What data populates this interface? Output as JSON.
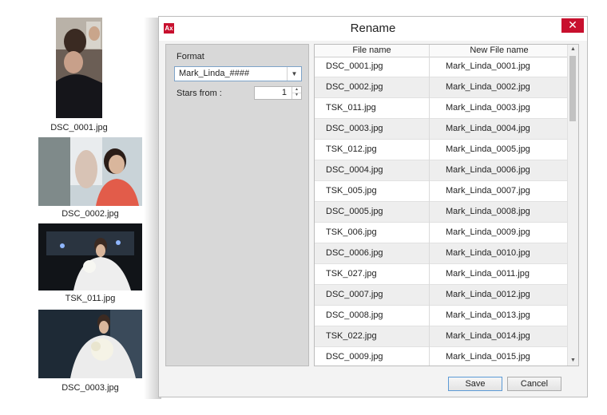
{
  "thumbnails": [
    {
      "caption": "DSC_0001.jpg"
    },
    {
      "caption": "DSC_0002.jpg"
    },
    {
      "caption": "TSK_011.jpg"
    },
    {
      "caption": "DSC_0003.jpg"
    }
  ],
  "dialog": {
    "title": "Rename",
    "app_icon_text": "Ax",
    "close_glyph": "✕"
  },
  "options": {
    "format_label": "Format",
    "format_value": "Mark_Linda_####",
    "stars_label": "Stars from :",
    "stars_value": "1"
  },
  "table": {
    "headers": [
      "File name",
      "New File name"
    ],
    "rows": [
      [
        "DSC_0001.jpg",
        "Mark_Linda_0001.jpg"
      ],
      [
        "DSC_0002.jpg",
        "Mark_Linda_0002.jpg"
      ],
      [
        "TSK_011.jpg",
        "Mark_Linda_0003.jpg"
      ],
      [
        "DSC_0003.jpg",
        "Mark_Linda_0004.jpg"
      ],
      [
        "TSK_012.jpg",
        "Mark_Linda_0005.jpg"
      ],
      [
        "DSC_0004.jpg",
        "Mark_Linda_0006.jpg"
      ],
      [
        "TSK_005.jpg",
        "Mark_Linda_0007.jpg"
      ],
      [
        "DSC_0005.jpg",
        "Mark_Linda_0008.jpg"
      ],
      [
        "TSK_006.jpg",
        "Mark_Linda_0009.jpg"
      ],
      [
        "DSC_0006.jpg",
        "Mark_Linda_0010.jpg"
      ],
      [
        "TSK_027.jpg",
        "Mark_Linda_0011.jpg"
      ],
      [
        "DSC_0007.jpg",
        "Mark_Linda_0012.jpg"
      ],
      [
        "DSC_0008.jpg",
        "Mark_Linda_0013.jpg"
      ],
      [
        "TSK_022.jpg",
        "Mark_Linda_0014.jpg"
      ],
      [
        "DSC_0009.jpg",
        "Mark_Linda_0015.jpg"
      ]
    ]
  },
  "buttons": {
    "save": "Save",
    "cancel": "Cancel"
  },
  "colors": {
    "close_red": "#c8102e",
    "focus_blue": "#5c9ad6"
  }
}
